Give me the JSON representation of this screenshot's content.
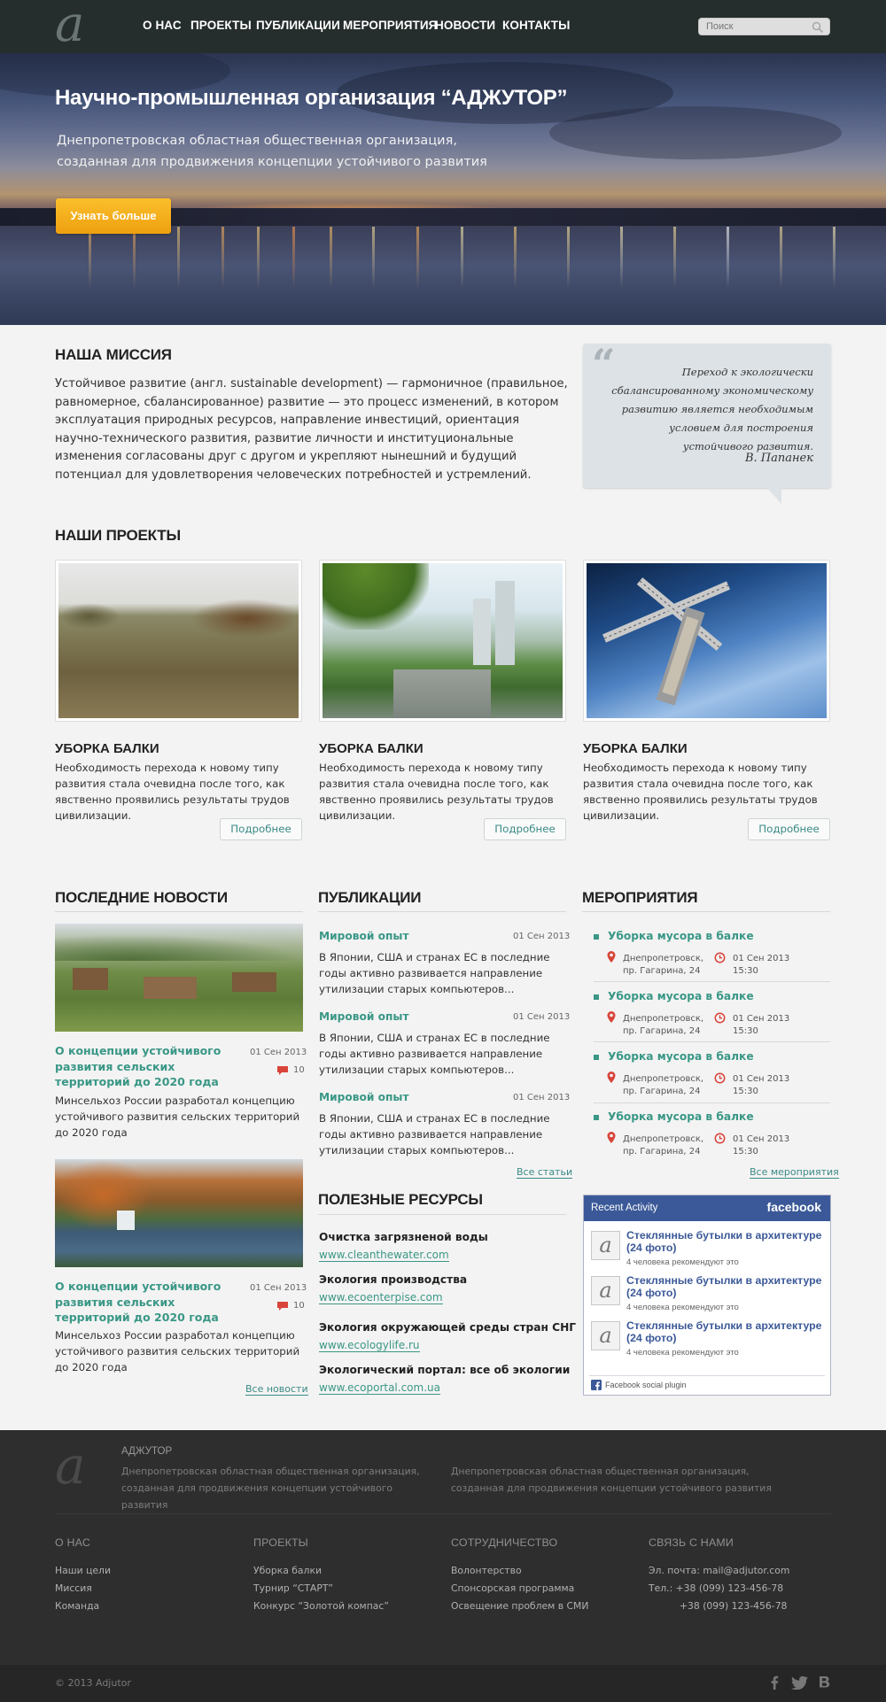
{
  "nav": {
    "items": [
      "О НАС",
      "ПРОЕКТЫ",
      "ПУБЛИКАЦИИ",
      "МЕРОПРИЯТИЯ",
      "НОВОСТИ",
      "КОНТАКТЫ"
    ],
    "search_placeholder": "Поиск"
  },
  "hero": {
    "title": "Научно-промышленная организация “АДЖУТОР”",
    "subtitle_line1": "Днепропетровская областная общественная организация,",
    "subtitle_line2": "созданная для продвижения концепции устойчивого развития",
    "button": "Узнать больше"
  },
  "mission": {
    "heading": "НАША МИССИЯ",
    "text": "Устойчивое развитие (англ. sustainable development) — гармоничное (правильное, равномерное, сбалансированное) развитие — это процесс изменений, в котором эксплуатация природных ресурсов, направление инвестиций, ориентация научно-технического развития, развитие личности и институциональные изменения согласованы друг с другом и укрепляют нынешний и будущий потенциал для удовлетворения человеческих потребностей и устремлений."
  },
  "quote": {
    "text": "Переход к экологически сбалансированному экономическому развитию является необходимым условием для построения устойчивого развития.",
    "author": "В. Папанек"
  },
  "projects": {
    "heading": "НАШИ ПРОЕКТЫ",
    "items": [
      {
        "title": "УБОРКА БАЛКИ",
        "text": "Необходимость перехода к новому типу развития стала очевидна после того, как явственно проявились результаты трудов цивилизации.",
        "button": "Подробнее"
      },
      {
        "title": "УБОРКА БАЛКИ",
        "text": "Необходимость перехода к новому типу развития стала очевидна после того, как явственно проявились результаты трудов цивилизации.",
        "button": "Подробнее"
      },
      {
        "title": "УБОРКА БАЛКИ",
        "text": "Необходимость перехода к новому типу развития стала очевидна после того, как явственно проявились результаты трудов цивилизации.",
        "button": "Подробнее"
      }
    ]
  },
  "news": {
    "heading": "ПОСЛЕДНИЕ НОВОСТИ",
    "items": [
      {
        "title": "О концепции устойчивого развития сельских территорий до 2020 года",
        "date": "01 Сен 2013",
        "comments": "10",
        "text": "Минсельхоз России разработал концепцию устойчивого развития сельских территорий до 2020 года"
      },
      {
        "title": "О концепции устойчивого развития сельских территорий до 2020 года",
        "date": "01 Сен 2013",
        "comments": "10",
        "text": "Минсельхоз России разработал концепцию устойчивого развития сельских территорий до 2020 года"
      }
    ],
    "all_link": "Все новости"
  },
  "publications": {
    "heading": "ПУБЛИКАЦИИ",
    "items": [
      {
        "title": "Мировой опыт",
        "date": "01 Сен 2013",
        "text": "В Японии, США и странах ЕС в последние годы активно развивается направление утилизации старых компьютеров..."
      },
      {
        "title": "Мировой опыт",
        "date": "01 Сен 2013",
        "text": "В Японии, США и странах ЕС в последние годы активно развивается направление утилизации старых компьютеров..."
      },
      {
        "title": "Мировой опыт",
        "date": "01 Сен 2013",
        "text": "В Японии, США и странах ЕС в последние годы активно развивается направление утилизации старых компьютеров..."
      }
    ],
    "all_link": "Все статьи"
  },
  "resources": {
    "heading": "ПОЛЕЗНЫЕ РЕСУРСЫ",
    "items": [
      {
        "title": "Очистка загрязненой воды",
        "url": "www.cleanthewater.com"
      },
      {
        "title": "Экология производства",
        "url": "www.ecoenterpise.com"
      },
      {
        "title": "Экология окружающей среды стран СНГ",
        "url": "www.ecologylife.ru"
      },
      {
        "title": "Экологический портал: все об экологии",
        "url": "www.ecoportal.com.ua"
      }
    ]
  },
  "events": {
    "heading": "МЕРОПРИЯТИЯ",
    "items": [
      {
        "title": "Уборка мусора в балке",
        "place1": "Днепропетровск,",
        "place2": "пр. Гагарина, 24",
        "date": "01 Сен 2013",
        "time": "15:30"
      },
      {
        "title": "Уборка мусора в балке",
        "place1": "Днепропетровск,",
        "place2": "пр. Гагарина, 24",
        "date": "01 Сен 2013",
        "time": "15:30"
      },
      {
        "title": "Уборка мусора в балке",
        "place1": "Днепропетровск,",
        "place2": "пр. Гагарина, 24",
        "date": "01 Сен 2013",
        "time": "15:30"
      },
      {
        "title": "Уборка мусора в балке",
        "place1": "Днепропетровск,",
        "place2": "пр. Гагарина, 24",
        "date": "01 Сен 2013",
        "time": "15:30"
      }
    ],
    "all_link": "Все мероприятия"
  },
  "facebook": {
    "header": "Recent Activity",
    "brand": "facebook",
    "items": [
      {
        "title": "Стеклянные бутылки в архитектуре (24 фото)",
        "sub": "4 человека рекомендуют это"
      },
      {
        "title": "Стеклянные бутылки в архитектуре (24 фото)",
        "sub": "4 человека рекомендуют это"
      },
      {
        "title": "Стеклянные бутылки в архитектуре (24 фото)",
        "sub": "4 человека рекомендуют это"
      }
    ],
    "plugin": "Facebook social plugin"
  },
  "footer": {
    "brand": "АДЖУТОР",
    "desc1": "Днепропетровская областная общественная организация,",
    "desc2": "созданная для продвижения концепции устойчивого развития",
    "cols": [
      {
        "heading": "О НАС",
        "links": [
          "Наши цели",
          "Миссия",
          "Команда"
        ]
      },
      {
        "heading": "ПРОЕКТЫ",
        "links": [
          "Уборка балки",
          "Турнир “СТАРТ”",
          "Конкурс “Золотой компас”"
        ]
      },
      {
        "heading": "СОТРУДНИЧЕСТВО",
        "links": [
          "Волонтерство",
          "Спонсорская программа",
          "Освещение проблем в СМИ"
        ]
      },
      {
        "heading": "СВЯЗЬ С НАМИ",
        "links": [
          "Эл. почта: mail@adjutor.com",
          "Тел.: +38 (099) 123-456-78",
          "+38 (099) 123-456-78"
        ]
      }
    ],
    "copyright": "© 2013 Adjutor"
  },
  "colors": {
    "accent": "#3a9786",
    "nav_bg": "#252e2c",
    "button_orange": "#f5a91b",
    "facebook": "#3b5998"
  }
}
